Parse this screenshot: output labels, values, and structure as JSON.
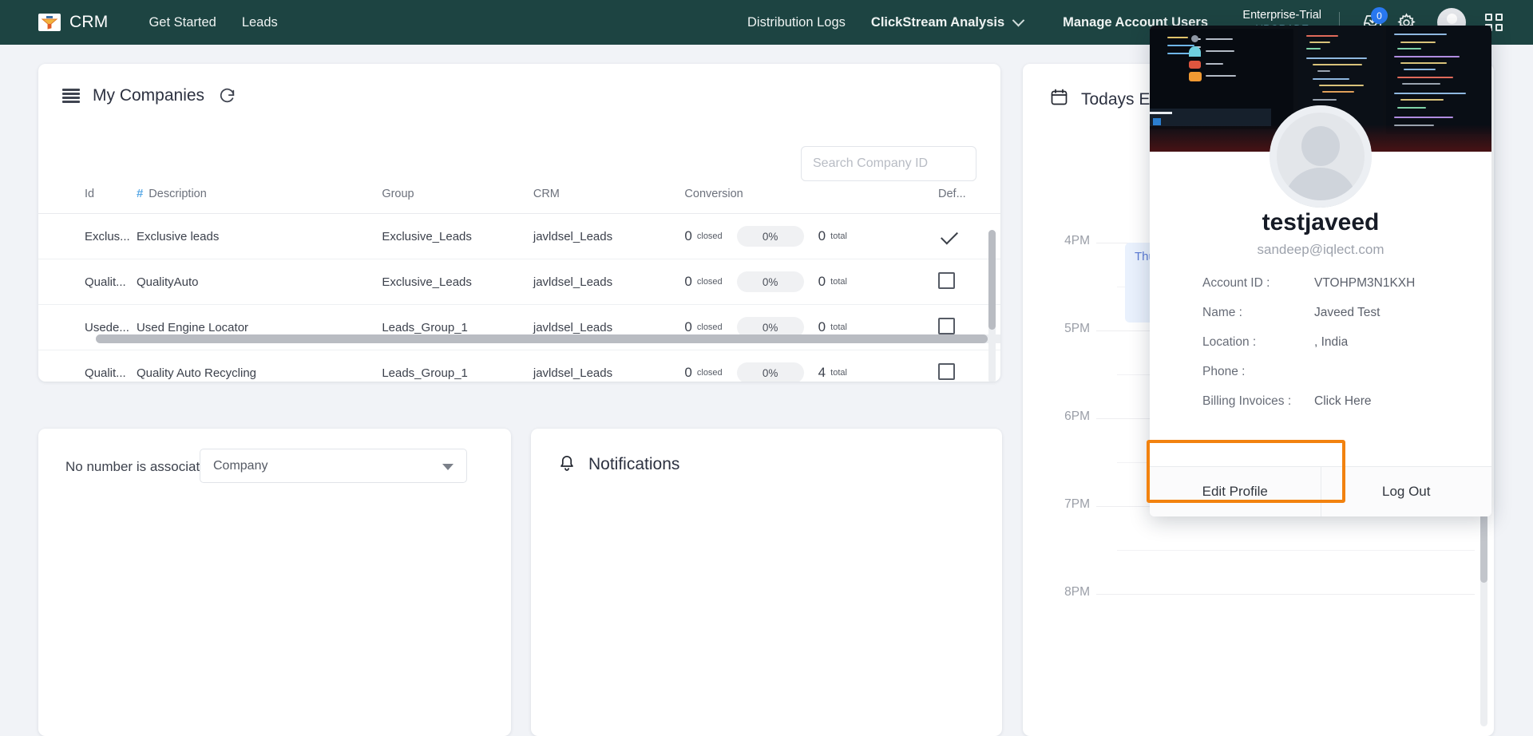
{
  "navbar": {
    "brand": "CRM",
    "brand_logo_icon": "funnel-logo-icon",
    "links_left": [
      {
        "label": "Get Started",
        "name": "nav-get-started"
      },
      {
        "label": "Leads",
        "name": "nav-leads"
      }
    ],
    "links_center": [
      {
        "label": "Distribution Logs",
        "name": "nav-distribution-logs",
        "bold": false,
        "chevron": false
      },
      {
        "label": "ClickStream Analysis",
        "name": "nav-clickstream-analysis",
        "bold": true,
        "chevron": true
      },
      {
        "label": "Manage Account Users",
        "name": "nav-manage-account-users",
        "bold": true,
        "chevron": false
      }
    ],
    "plan": {
      "name": "Enterprise-Trial",
      "upgrade_label": "UPGRADE"
    },
    "inbox_badge": "0",
    "icons": {
      "inbox": "inbox-download-icon",
      "settings": "gear-icon",
      "avatar": "avatar-icon",
      "apps": "apps-grid-icon"
    },
    "accent_color": "#1d4442",
    "badge_color": "#2979f2",
    "upgrade_color": "#7fd4ee"
  },
  "companies": {
    "title": "My Companies",
    "refresh_icon": "refresh-icon",
    "list_icon": "list-lines-icon",
    "search": {
      "value": "",
      "placeholder": "Search Company ID"
    },
    "columns": [
      "Id",
      "Description",
      "Group",
      "CRM",
      "Conversion",
      "Def..."
    ],
    "rows": [
      {
        "id": "Exclus...",
        "description": "Exclusive leads",
        "group": "Exclusive_Leads",
        "crm": "javldsel_Leads",
        "closed": "0",
        "closed_label": "closed",
        "percent": "0%",
        "total": "0",
        "total_label": "total",
        "default": true
      },
      {
        "id": "Qualit...",
        "description": "QualityAuto",
        "group": "Exclusive_Leads",
        "crm": "javldsel_Leads",
        "closed": "0",
        "closed_label": "closed",
        "percent": "0%",
        "total": "0",
        "total_label": "total",
        "default": false
      },
      {
        "id": "Usede...",
        "description": "Used Engine Locator",
        "group": "Leads_Group_1",
        "crm": "javldsel_Leads",
        "closed": "0",
        "closed_label": "closed",
        "percent": "0%",
        "total": "0",
        "total_label": "total",
        "default": false
      },
      {
        "id": "Qualit...",
        "description": "Quality Auto Recycling",
        "group": "Leads_Group_1",
        "crm": "javldsel_Leads",
        "closed": "0",
        "closed_label": "closed",
        "percent": "0%",
        "total": "4",
        "total_label": "total",
        "default": false
      }
    ]
  },
  "phone_card": {
    "message": "No number is associated with your account"
  },
  "notifications": {
    "title": "Notifications",
    "bell_icon": "bell-icon",
    "filter_selected": "Company",
    "filter_options": [
      "Company"
    ]
  },
  "events": {
    "title": "Todays Events",
    "calendar_icon": "calendar-icon",
    "time_labels": [
      "4PM",
      "5PM",
      "6PM",
      "7PM",
      "8PM"
    ],
    "items": [
      {
        "label": "Thursday",
        "start": "4PM"
      }
    ]
  },
  "profile_dropdown": {
    "cover_image": "code-editor-monitors-photo",
    "avatar_icon": "avatar-placeholder-icon",
    "username": "testjaveed",
    "email": "sandeep@iqlect.com",
    "fields": [
      {
        "label": "Account ID :",
        "value": "VTOHPM3N1KXH"
      },
      {
        "label": "Name :",
        "value": "Javeed Test"
      },
      {
        "label": "Location :",
        "value": ", India"
      },
      {
        "label": "Phone :",
        "value": ""
      },
      {
        "label": "Billing Invoices :",
        "value": "Click Here"
      }
    ],
    "edit_profile_label": "Edit Profile",
    "log_out_label": "Log Out",
    "highlight_color": "#f2820f"
  }
}
